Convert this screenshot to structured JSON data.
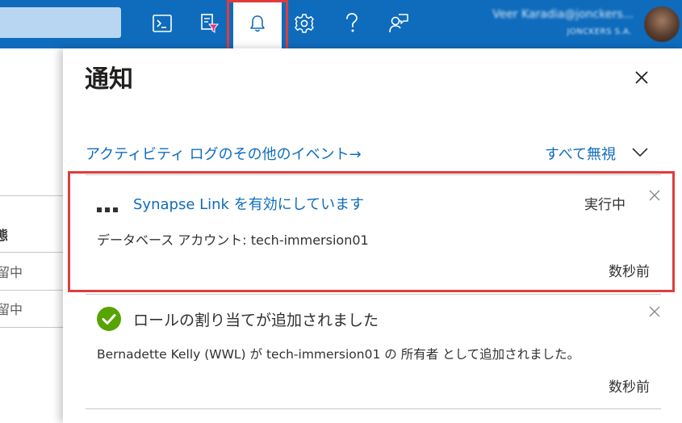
{
  "topbar": {
    "icons": [
      "cloud-shell-icon",
      "directory-filter-icon",
      "bell-icon",
      "gear-icon",
      "help-icon",
      "feedback-icon"
    ],
    "user_name": "Veer Karadia@jonckers...",
    "user_org": "JONCKERS S.A."
  },
  "background_page": {
    "column_header": "態",
    "rows": [
      "留中",
      "留中"
    ]
  },
  "panel": {
    "title": "通知",
    "activity_log_link": "アクティビティ ログのその他のイベント→",
    "dismiss_all": "すべて無視",
    "notifications": [
      {
        "title": "Synapse Link を有効にしています",
        "status": "実行中",
        "body": "データベース アカウント: tech-immersion01",
        "time": "数秒前"
      },
      {
        "title": "ロールの割り当てが追加されました",
        "body": "Bernadette Kelly (WWL) が tech-immersion01 の 所有者 として追加されました。",
        "time": "数秒前"
      }
    ]
  },
  "colors": {
    "topbar": "#0f6cbd",
    "link": "#0f6cbd",
    "highlight": "#e03c3c",
    "success": "#57a300"
  }
}
